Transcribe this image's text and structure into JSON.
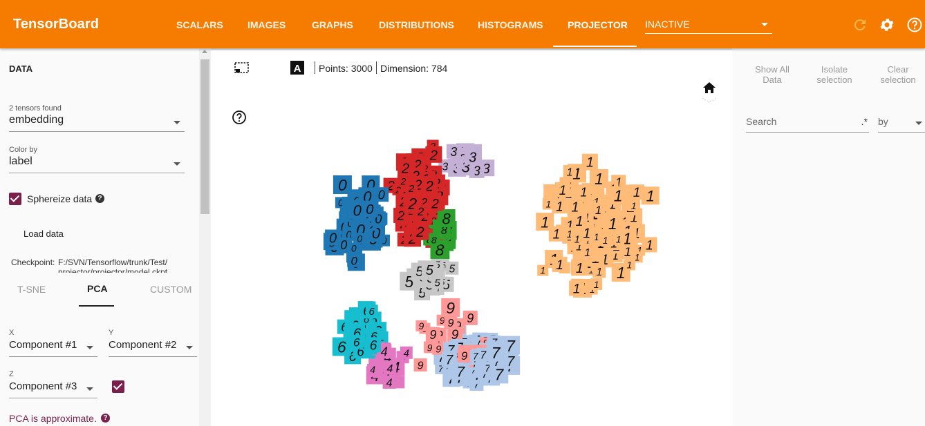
{
  "header": {
    "brand": "TensorBoard",
    "tabs": [
      {
        "label": "SCALARS"
      },
      {
        "label": "IMAGES"
      },
      {
        "label": "GRAPHS"
      },
      {
        "label": "DISTRIBUTIONS"
      },
      {
        "label": "HISTOGRAMS"
      },
      {
        "label": "PROJECTOR",
        "active": true
      }
    ],
    "run_selector": "INACTIVE",
    "icons": [
      "refresh-icon",
      "settings-icon",
      "help-icon"
    ],
    "accent_color": "#f57c00"
  },
  "sidebar": {
    "section_title": "DATA",
    "tensors_label": "2 tensors found",
    "tensor_value": "embedding",
    "colorby_label": "Color by",
    "colorby_value": "label",
    "sphereize_label": "Sphereize data",
    "sphereize_checked": true,
    "load_data": "Load data",
    "checkpoint_label": "Checkpoint:",
    "checkpoint_value": "F:/SVN/Tensorflow/trunk/Test/",
    "checkpoint_value2": "projector/projector/model.ckpt",
    "method_tabs": [
      {
        "label": "T-SNE"
      },
      {
        "label": "PCA",
        "active": true
      },
      {
        "label": "CUSTOM"
      }
    ],
    "x_label": "X",
    "x_value": "Component #1",
    "y_label": "Y",
    "y_value": "Component #2",
    "z_label": "Z",
    "z_value": "Component #3",
    "z_checked": true,
    "pca_note": "PCA is approximate."
  },
  "toolbar": {
    "points": "Points: 3000",
    "dimension": "Dimension: 784",
    "icons": [
      "selection-icon",
      "night-mode-icon",
      "label-icon",
      "home-icon",
      "help-icon"
    ]
  },
  "rightpanel": {
    "show_all": [
      "Show All",
      "Data"
    ],
    "isolate": [
      "Isolate",
      "selection"
    ],
    "clear": [
      "Clear",
      "selection"
    ],
    "search_placeholder": "Search",
    "regex_label": ".*",
    "by_label": "by"
  },
  "label_colors": {
    "0": "#1f77b4",
    "1": "#ffbb78",
    "2": "#d62728",
    "3": "#c5b0d5",
    "4": "#e377c2",
    "5": "#c7c7c7",
    "6": "#17becf",
    "7": "#aec7e8",
    "8": "#2ca02c",
    "9": "#ff9896"
  }
}
